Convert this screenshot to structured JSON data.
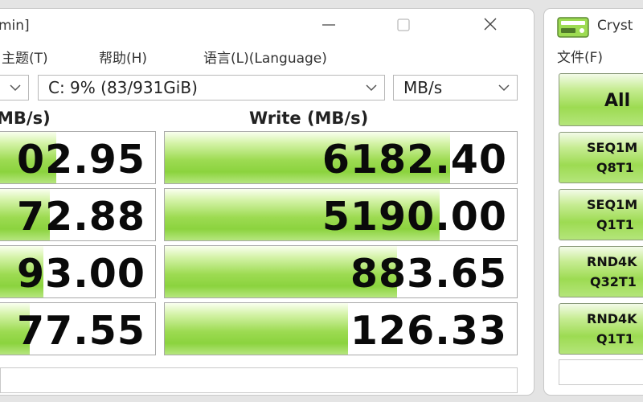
{
  "main_window": {
    "title_fragment": "min]",
    "menu": [
      "主题(T)",
      "帮助(H)",
      "语言(L)(Language)"
    ],
    "drive_select": "C: 9% (83/931GiB)",
    "unit_select": "MB/s",
    "read_header": "MB/s)",
    "write_header": "Write (MB/s)",
    "rows": [
      {
        "read": "02.95",
        "write": "6182.40",
        "read_fill": 0.38,
        "write_fill": 0.81
      },
      {
        "read": "72.88",
        "write": "5190.00",
        "read_fill": 0.34,
        "write_fill": 0.78
      },
      {
        "read": "93.00",
        "write": "883.65",
        "read_fill": 0.3,
        "write_fill": 0.66
      },
      {
        "read": "77.55",
        "write": "126.33",
        "read_fill": 0.21,
        "write_fill": 0.52
      }
    ]
  },
  "side_window": {
    "title_fragment": "Cryst",
    "menu_item": "文件(F)",
    "all_button": "All",
    "tests": [
      {
        "line1": "SEQ1M",
        "line2": "Q8T1"
      },
      {
        "line1": "SEQ1M",
        "line2": "Q1T1"
      },
      {
        "line1": "RND4K",
        "line2": "Q32T1"
      },
      {
        "line1": "RND4K",
        "line2": "Q1T1"
      }
    ]
  },
  "colors": {
    "accent_green": "#8bd33e",
    "window_bg": "#ffffff",
    "desktop_bg": "#e4e4e4"
  }
}
